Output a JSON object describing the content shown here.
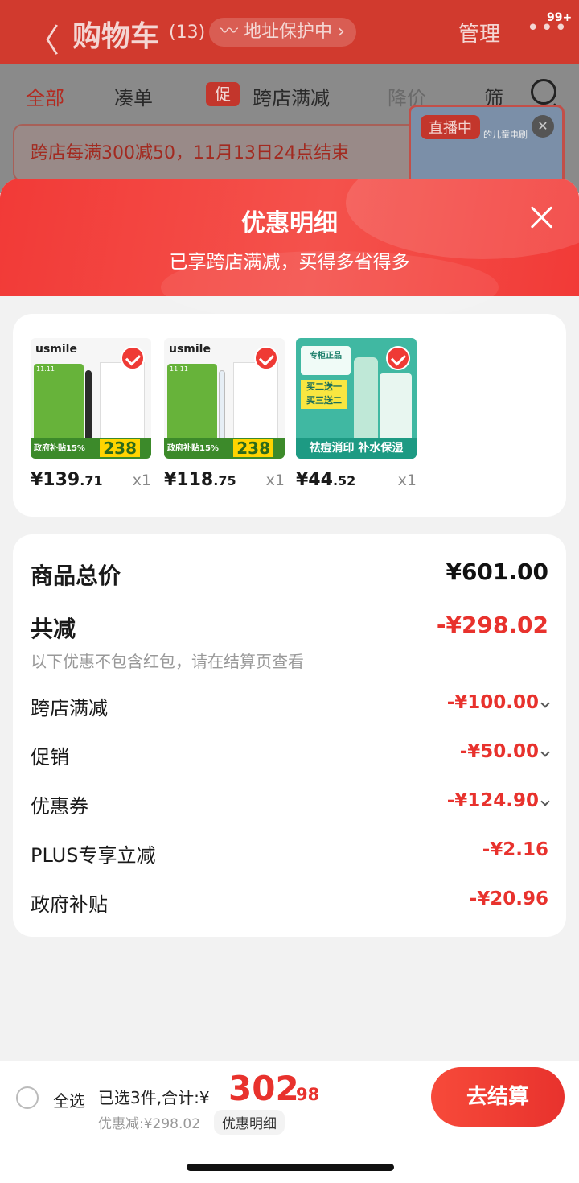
{
  "background": {
    "back_glyph": "〈",
    "title": "购物车",
    "count": "(13)",
    "protect": "〰 地址保护中 ›",
    "manage": "管理",
    "more": "•••",
    "badge": "99+",
    "tabs": [
      "全部",
      "凑单",
      "跨店满减",
      "降价",
      "筛"
    ],
    "promo_icon": "促",
    "banner": "跨店每满300减50，11月13日24点结束",
    "live_tag": "直播中",
    "live_text": "的儿童电刷"
  },
  "sheet": {
    "title": "优惠明细",
    "subtitle": "已享跨店满减，买得多省得多"
  },
  "products": [
    {
      "price_int": "¥139",
      "price_dec": ".71",
      "qty": "x1",
      "brand": "usmile",
      "promo_value": "238",
      "bottom_text": "政府补贴15%",
      "brush_color": "#2a2a2a"
    },
    {
      "price_int": "¥118",
      "price_dec": ".75",
      "qty": "x1",
      "brand": "usmile",
      "promo_value": "238",
      "bottom_text": "政府补贴15%",
      "brush_color": "#e6eef5"
    },
    {
      "price_int": "¥44",
      "price_dec": ".52",
      "qty": "x1",
      "top_text": "专柜正品",
      "promo": "买二送一 买三送二",
      "bottom_text": "祛痘消印 补水保湿"
    }
  ],
  "summary": {
    "total_label": "商品总价",
    "total_value": "¥601.00",
    "reduce_label": "共减",
    "reduce_value": "-¥298.02",
    "note": "以下优惠不包含红包，请在结算页查看",
    "items": [
      {
        "label": "跨店满减",
        "value": "-¥100.00",
        "expandable": true
      },
      {
        "label": "促销",
        "value": "-¥50.00",
        "expandable": true
      },
      {
        "label": "优惠券",
        "value": "-¥124.90",
        "expandable": true
      },
      {
        "label": "PLUS专享立减",
        "value": "-¥2.16",
        "expandable": false
      },
      {
        "label": "政府补贴",
        "value": "-¥20.96",
        "expandable": false
      }
    ]
  },
  "bottom_bar": {
    "select_all": "全选",
    "selected": "已选3件,合计:¥",
    "total_int": "302",
    "total_dec": ".98",
    "discount": "优惠减:¥298.02",
    "detail_chip": "优惠明细",
    "checkout": "去结算"
  },
  "colors": {
    "accent": "#e8322d",
    "header_bg": "#d13a2e"
  }
}
